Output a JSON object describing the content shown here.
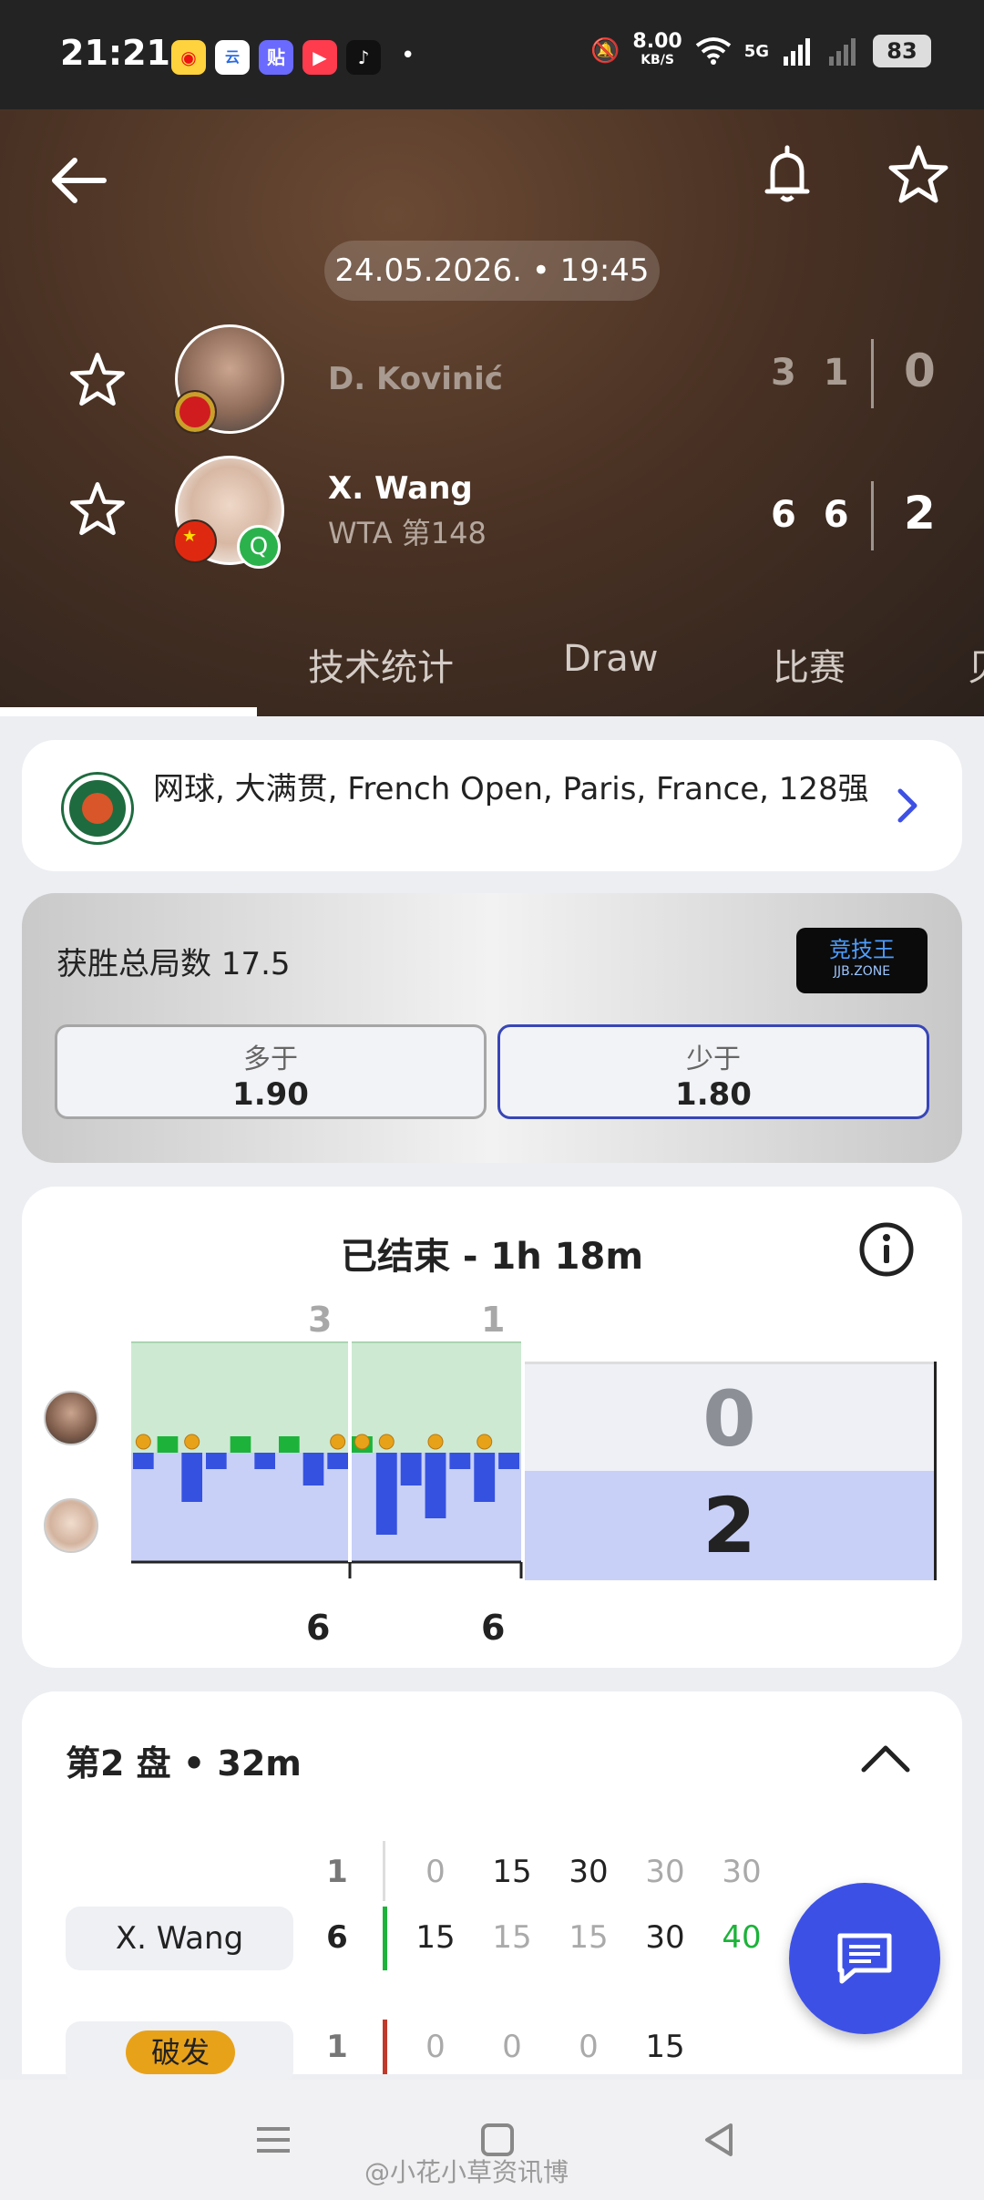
{
  "status_bar": {
    "time": "21:21",
    "apps": [
      "weibo",
      "Ai",
      "tieba",
      "video",
      "tiktok"
    ],
    "speed_value": "8.00",
    "speed_unit": "KB/S",
    "network": "5G",
    "battery": "83"
  },
  "header": {
    "datetime": "24.05.2026. • 19:45",
    "players": [
      {
        "name": "D. Kovinić",
        "rank": "",
        "flag": "Montenegro",
        "set_scores": "3 1",
        "sets_won": "0",
        "winner": false
      },
      {
        "name": "X. Wang",
        "rank": "WTA 第148",
        "flag": "China",
        "badge": "Q",
        "set_scores": "6 6",
        "sets_won": "2",
        "winner": true
      }
    ]
  },
  "tabs": [
    "技术统计",
    "Draw",
    "比赛",
    "贝"
  ],
  "tournament": {
    "text": "网球, 大满贯, French Open, Paris, France, 128强"
  },
  "odds": {
    "title": "获胜总局数 17.5",
    "sponsor": "竞技王",
    "sponsor_sub": "JJB.ZONE",
    "options": [
      {
        "label": "多于",
        "value": "1.90",
        "selected": false
      },
      {
        "label": "少于",
        "value": "1.80",
        "selected": true
      }
    ]
  },
  "momentum": {
    "title": "已结束 - 1h 18m",
    "set_scores_top": [
      "3",
      "1"
    ],
    "set_scores_bottom": [
      "6",
      "6"
    ],
    "summary": {
      "top": "0",
      "bottom": "2"
    },
    "colors": {
      "top": "#cde9d2",
      "bottom": "#c8d0f8",
      "bar_top": "#1db33a",
      "bar_bottom": "#3551e0",
      "serve": "#e8a21a"
    },
    "bars": [
      {
        "set": 1,
        "v": -1,
        "serve": true
      },
      {
        "set": 1,
        "v": 1,
        "serve": false
      },
      {
        "set": 1,
        "v": -3,
        "serve": true
      },
      {
        "set": 1,
        "v": -1,
        "serve": false
      },
      {
        "set": 1,
        "v": 1,
        "serve": false
      },
      {
        "set": 1,
        "v": -1,
        "serve": false
      },
      {
        "set": 1,
        "v": 1,
        "serve": false
      },
      {
        "set": 1,
        "v": -2,
        "serve": false
      },
      {
        "set": 1,
        "v": -1,
        "serve": true
      },
      {
        "set": 2,
        "v": 1,
        "serve": true
      },
      {
        "set": 2,
        "v": -5,
        "serve": true
      },
      {
        "set": 2,
        "v": -2,
        "serve": false
      },
      {
        "set": 2,
        "v": -4,
        "serve": true
      },
      {
        "set": 2,
        "v": -1,
        "serve": false
      },
      {
        "set": 2,
        "v": -3,
        "serve": true
      },
      {
        "set": 2,
        "v": -1,
        "serve": false
      }
    ]
  },
  "set_detail": {
    "title": "第2 盘 • 32m",
    "rows": [
      {
        "label": "",
        "games": "1",
        "points": [
          "0",
          "15",
          "30",
          "30",
          "30"
        ],
        "emph": [
          false,
          true,
          true,
          false,
          false
        ]
      },
      {
        "label": "X. Wang",
        "games": "6",
        "points": [
          "15",
          "15",
          "15",
          "30",
          "40"
        ],
        "emph": [
          true,
          false,
          false,
          true,
          false
        ]
      },
      {
        "label": "破发",
        "games": "1",
        "points": [
          "0",
          "0",
          "0",
          "15",
          ""
        ],
        "emph": [
          false,
          false,
          false,
          true,
          false
        ]
      }
    ],
    "accent_green": "#1db33a",
    "accent_red": "#c0392b"
  },
  "watermark": "@小花小草资讯博"
}
